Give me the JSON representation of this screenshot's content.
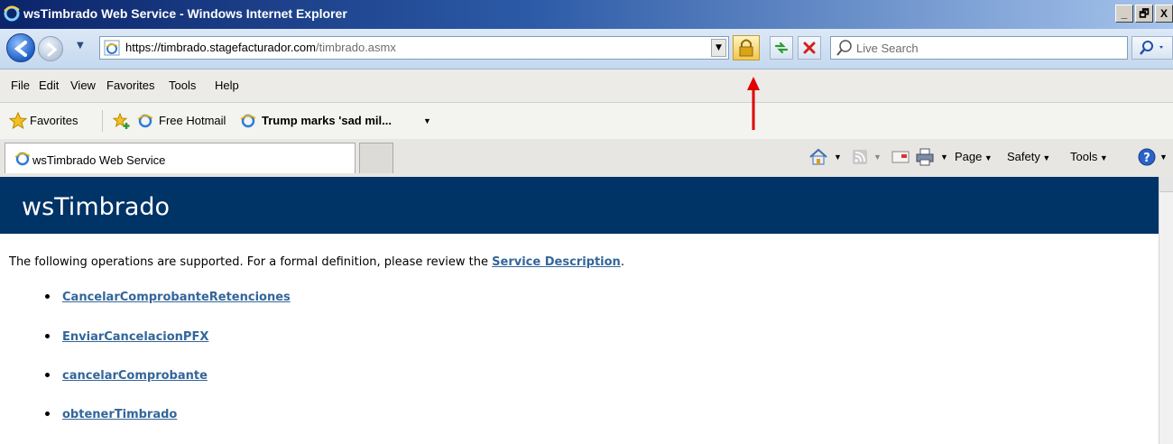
{
  "window": {
    "title": "wsTimbrado Web Service - Windows Internet Explorer",
    "controls": [
      "_",
      "🗗",
      "X"
    ]
  },
  "address_bar": {
    "url_scheme_host": "https://timbrado.stagefacturador.com",
    "url_path": "/timbrado.asmx",
    "search_placeholder": "Live Search"
  },
  "menu": {
    "items": [
      "File",
      "Edit",
      "View",
      "Favorites",
      "Tools",
      "Help"
    ]
  },
  "favorites_bar": {
    "favorites_label": "Favorites",
    "links": [
      "Free Hotmail",
      "Trump marks 'sad mil..."
    ]
  },
  "tabs": {
    "active_label": "wsTimbrado Web Service"
  },
  "command_bar": {
    "items": [
      "Page",
      "Safety",
      "Tools"
    ]
  },
  "page": {
    "heading": "wsTimbrado",
    "intro_text": "The following operations are supported. For a formal definition, please review the",
    "service_description_link": "Service Description",
    "intro_end": ".",
    "operations": [
      "CancelarComprobanteRetenciones",
      "EnviarCancelacionPFX",
      "cancelarComprobante",
      "obtenerTimbrado"
    ]
  },
  "colors": {
    "header_bg": "#003366",
    "link": "#336699",
    "annotation_arrow": "#e00000"
  }
}
